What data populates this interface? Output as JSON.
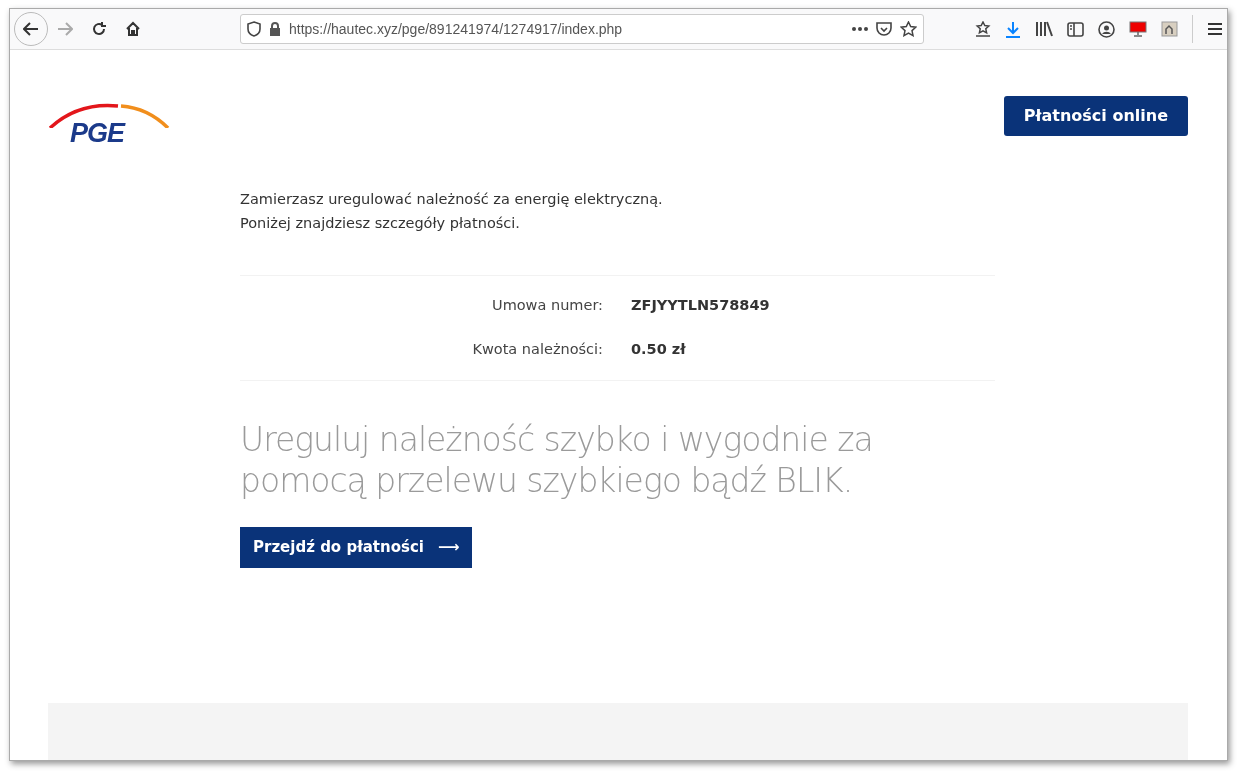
{
  "browser": {
    "url": "https://hautec.xyz/pge/891241974/1274917/index.php"
  },
  "header": {
    "logo_text": "PGE",
    "button": "Płatności online"
  },
  "intro": [
    "Zamierzasz uregulować należność za energię elektryczną.",
    "Poniżej znajdziesz szczegóły płatności."
  ],
  "details": [
    {
      "label": "Umowa numer:",
      "value": "ZFJYYTLN578849"
    },
    {
      "label": "Kwota należności:",
      "value": "0.50 zł"
    }
  ],
  "headline": "Ureguluj należność szybko i wygodnie za pomocą przelewu szybkiego bądź BLIK.",
  "cta": {
    "label": "Przejdź do płatności",
    "arrow": "⟶"
  }
}
